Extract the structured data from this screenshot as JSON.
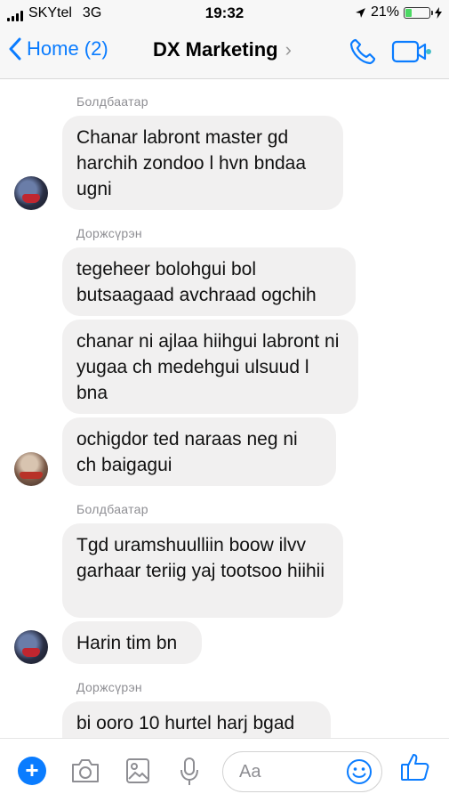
{
  "status_bar": {
    "carrier": "SKYtel",
    "network": "3G",
    "time": "19:32",
    "battery_percent": "21%",
    "battery_level": 0.21
  },
  "nav": {
    "back_label": "Home (2)",
    "title": "DX Marketing",
    "title_chevron": "›",
    "icons": [
      "back-chevron-icon",
      "phone-icon",
      "video-camera-icon"
    ]
  },
  "colors": {
    "accent": "#0a7cff",
    "bubble": "#f1f0f0",
    "sender_name": "#8e8e93"
  },
  "messages": [
    {
      "sender": "Болдбаатар",
      "bubbles": [
        "Chanar labront master gd harchih zondoo l hvn bndaa ugni"
      ]
    },
    {
      "sender": "Доржсүрэн",
      "bubbles": [
        "tegeheer bolohgui bol butsaagaad avchraad ogchih",
        "chanar ni ajlaa hiihgui labront ni yugaa ch medehgui ulsuud l bna",
        "ochigdor ted naraas neg ni ch baigagui"
      ]
    },
    {
      "sender": "Болдбаатар",
      "bubbles": [
        "Tgd uramshuulliin boow ilvv garhaar teriig yaj tootsoo hiihii",
        "Harin tim bn"
      ]
    },
    {
      "sender": "Доржсүрэн",
      "bubbles": [
        "bi ooro 10 hurtel harj bgad"
      ]
    }
  ],
  "composer": {
    "placeholder": "Aa",
    "plus_label": "+",
    "icons": [
      "plus-icon",
      "camera-icon",
      "photo-icon",
      "microphone-icon",
      "emoji-icon",
      "thumbs-up-icon"
    ]
  }
}
